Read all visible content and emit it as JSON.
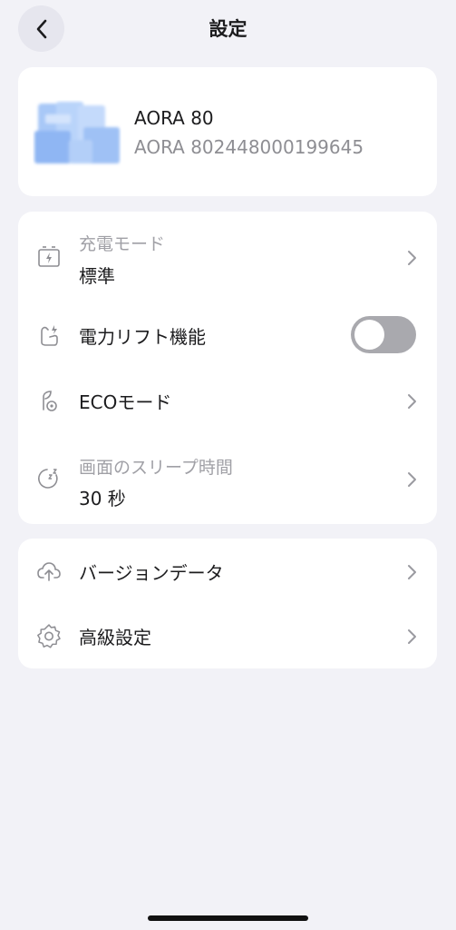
{
  "header": {
    "title": "設定"
  },
  "device": {
    "name": "AORA 80",
    "serial": "AORA 802448000199645"
  },
  "settings": {
    "charge_mode": {
      "label": "充電モード",
      "value": "標準"
    },
    "power_lift": {
      "label": "電力リフト機能",
      "enabled": false
    },
    "eco_mode": {
      "label": "ECOモード"
    },
    "sleep_time": {
      "label": "画面のスリープ時間",
      "value": "30 秒"
    }
  },
  "more": {
    "version_data": "バージョンデータ",
    "advanced_settings": "高級設定"
  },
  "icons": {
    "back": "chevron-left-icon",
    "charge_mode": "battery-charge-icon",
    "power_lift": "power-lift-icon",
    "eco_mode": "eco-leaf-icon",
    "sleep_time": "sleep-timer-icon",
    "version_data": "cloud-upload-icon",
    "advanced_settings": "gear-icon"
  },
  "colors": {
    "background": "#f2f2f7",
    "card": "#ffffff",
    "toggle_off": "#a9a9ae",
    "secondary_text": "#8e8e93",
    "device_image": "#9ec2f5"
  }
}
